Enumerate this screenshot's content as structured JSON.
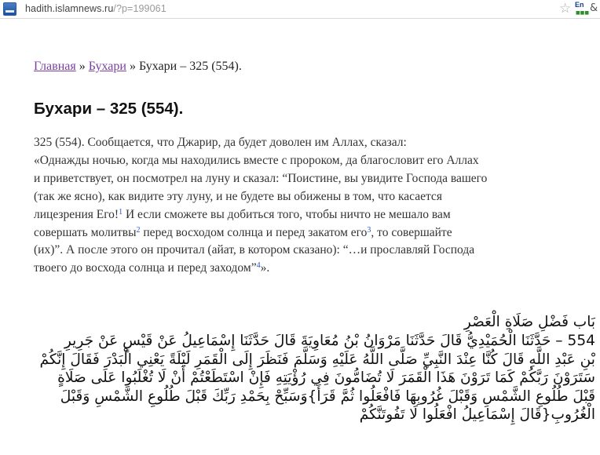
{
  "browser": {
    "url_host": "hadith.islamnews.ru",
    "url_path": "/?p=199061",
    "bookmark_icon": "star-icon",
    "translate_icon": "language-icon",
    "translate_label": "En",
    "menu_icon": "wrench-icon"
  },
  "breadcrumb": {
    "home": "Главная",
    "sep1": " » ",
    "category": "Бухари",
    "sep2": " » ",
    "current": "Бухари – 325 (554)."
  },
  "title": "Бухари – 325 (554).",
  "body": {
    "l1": "325 (554). Сообщается, что Джарир, да будет доволен им Аллах, сказал:",
    "l2": "«Однажды ночью, когда мы находились вместе с пророком, да благословит его Аллах",
    "l3": "и приветствует, он посмотрел на луну и сказал: “Поистине, вы увидите Господа вашего",
    "l4": "(так же ясно), как видите эту луну, и не будете вы обижены в том, что касается",
    "l5a": "лицезрения Его!",
    "fn1": "1",
    "l5b": " И если сможете вы добиться того, чтобы ничто не мешало вам",
    "l6a": "совершать молитвы",
    "fn2": "2",
    "l6b": " перед восходом солнца и перед закатом его",
    "fn3": "3",
    "l6c": ", то совершайте",
    "l7": "(их)”. А после этого он прочитал (айат, в котором сказано): “…и прославляй Господа",
    "l8a": "твоего до восхода солнца и перед заходом”",
    "fn4": "4",
    "l8b": "»."
  },
  "arabic": {
    "heading": "بَاب فَضْلِ صَلَاةِ الْعَصْرِ",
    "l1": "554 – حَدَّثَنَا الْحُمَيْدِيُّ قَالَ حَدَّثَنَا مَرْوَانُ بْنُ مُعَاوِيَةَ قَالَ حَدَّثَنَا إِسْمَاعِيلُ عَنْ قَيْسٍ عَنْ جَرِيرِ",
    "l2": "بْنِ عَبْدِ اللَّهِ قَالَ كُنَّا عِنْدَ النَّبِيِّ صَلَّى اللَّهُ عَلَيْهِ وَسَلَّمَ فَنَظَرَ إِلَى الْقَمَرِ لَيْلَةً يَعْنِي الْبَدْرَ فَقَالَ إِنَّكُمْ",
    "l3": "سَتَرَوْنَ رَبَّكُمْ كَمَا تَرَوْنَ هَذَا الْقَمَرَ لَا تُضَامُّونَ فِي رُؤْيَتِهِ فَإِنْ اسْتَطَعْتُمْ أَنْ لَا تُغْلَبُوا عَلَى صَلَاةٍ",
    "l4": "قَبْلَ طُلُوعِ الشَّمْسِ وَقَبْلَ غُرُوبِهَا فَافْعَلُوا ثُمَّ قَرَأَ}وَسَبِّحْ بِحَمْدِ رَبِّكَ قَبْلَ طُلُوعِ الشَّمْسِ وَقَبْلَ",
    "l5": "الْغُرُوبِ{قَالَ إِسْمَاعِيلُ افْعَلُوا لَا تَفُوتَنَّكُمْ"
  }
}
